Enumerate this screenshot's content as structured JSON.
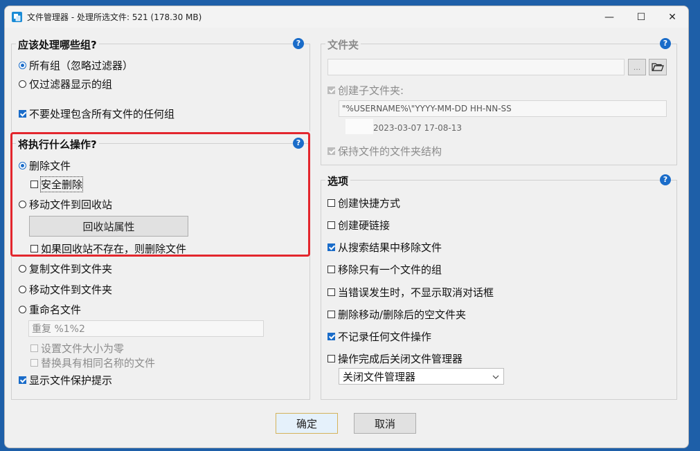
{
  "window": {
    "title": "文件管理器 - 处理所选文件: 521 (178.30 MB)",
    "minimize_glyph": "—",
    "maximize_glyph": "☐",
    "close_glyph": "✕"
  },
  "groups_section": {
    "title": "应该处理哪些组?",
    "help": "?",
    "options": [
      {
        "label": "所有组（忽略过滤器）",
        "checked": true
      },
      {
        "label": "仅过滤器显示的组",
        "checked": false
      }
    ],
    "skip_all_files_group": {
      "label": "不要处理包含所有文件的任何组",
      "checked": true
    }
  },
  "action_section": {
    "title": "将执行什么操作?",
    "help": "?",
    "delete_files": "删除文件",
    "safe_delete": "安全删除",
    "move_to_recycle": "移动文件到回收站",
    "recycle_props_button": "回收站属性",
    "delete_if_no_recycle": "如果回收站不存在，则删除文件",
    "copy_to_folder": "复制文件到文件夹",
    "move_to_folder": "移动文件到文件夹",
    "rename_files": "重命名文件",
    "rename_pattern": "重复 %1%2",
    "set_size_zero": "设置文件大小为零",
    "replace_same_name": "替换具有相同名称的文件",
    "show_protection_tip": "显示文件保护提示"
  },
  "folder_section": {
    "title": "文件夹",
    "help": "?",
    "path_value": "",
    "browse_label": "...",
    "folder_icon": "folder-open-icon",
    "create_subfolder": "创建子文件夹:",
    "subfolder_pattern": "\"%USERNAME%\\\"YYYY-MM-DD HH-NN-SS",
    "preview": "2023-03-07 17-08-13",
    "keep_structure": "保持文件的文件夹结构"
  },
  "options_section": {
    "title": "选项",
    "help": "?",
    "items": [
      {
        "label": "创建快捷方式",
        "checked": false
      },
      {
        "label": "创建硬链接",
        "checked": false
      },
      {
        "label": "从搜索结果中移除文件",
        "checked": true
      },
      {
        "label": "移除只有一个文件的组",
        "checked": false
      },
      {
        "label": "当错误发生时，不显示取消对话框",
        "checked": false
      },
      {
        "label": "删除移动/删除后的空文件夹",
        "checked": false
      },
      {
        "label": "不记录任何文件操作",
        "checked": true
      },
      {
        "label": "操作完成后关闭文件管理器",
        "checked": false
      }
    ],
    "close_select_value": "关闭文件管理器"
  },
  "footer": {
    "ok": "确定",
    "cancel": "取消"
  },
  "colors": {
    "accent": "#1a6cc9",
    "highlight": "#e3262d",
    "desktop": "#1e5fa8"
  }
}
